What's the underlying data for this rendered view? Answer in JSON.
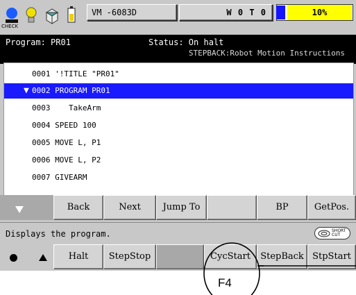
{
  "toolbar": {
    "check_label": "CHECK",
    "icons": [
      "check-icon",
      "bulb-icon",
      "cube-icon",
      "battery-icon"
    ],
    "mode_text": "VM  -6083D",
    "status_text": "W 0 T 0",
    "speed_label": "10%",
    "speed_level_percent": 10,
    "colors": {
      "speed_bar": "#1414ff",
      "speed_fill": "#ffff00"
    }
  },
  "status": {
    "program": "Program: PR01",
    "state": "Status: On halt",
    "mode": "STEPBACK:Robot Motion Instructions"
  },
  "program_lines": [
    {
      "text": "0001 '!TITLE \"PR01\"",
      "selected": false
    },
    {
      "text": "0002 PROGRAM PR01",
      "selected": true
    },
    {
      "text": "0003    TakeArm",
      "selected": false
    },
    {
      "text": "0004 SPEED 100",
      "selected": false
    },
    {
      "text": "0005 MOVE L, P1",
      "selected": false
    },
    {
      "text": "0006 MOVE L, P2",
      "selected": false
    },
    {
      "text": "0007 GIVEARM",
      "selected": false
    }
  ],
  "function_keys_top": [
    "Back",
    "Next",
    "Jump To",
    "",
    "BP",
    "GetPos."
  ],
  "message": "Displays the program.",
  "shortcut_label_top": "SHORT",
  "shortcut_label_bottom": "CUT",
  "function_keys_bottom": [
    "Halt",
    "StepStop",
    "",
    "CycStart",
    "StepBack",
    "StpStart"
  ],
  "callout_label": "F4"
}
